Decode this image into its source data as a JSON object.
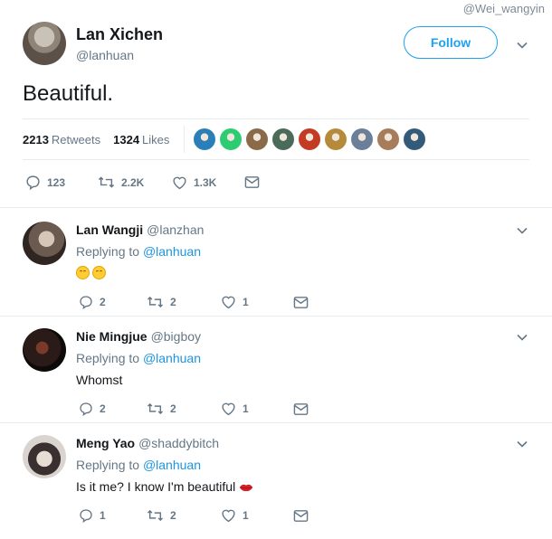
{
  "watermark": "@Wei_wangyin",
  "tweet": {
    "name": "Lan Xichen",
    "handle": "@lanhuan",
    "follow_label": "Follow",
    "text": "Beautiful.",
    "retweets_count": "2213",
    "retweets_label": "Retweets",
    "likes_count": "1324",
    "likes_label": "Likes",
    "actions": {
      "replies": "123",
      "retweets": "2.2K",
      "likes": "1.3K"
    }
  },
  "likers": [
    "#2a7fb8",
    "#2ecc71",
    "#8b6a4a",
    "#4a6b5a",
    "#c23b22",
    "#b58a3a",
    "#6b7f99",
    "#a67c5a",
    "#345a7a"
  ],
  "replies": [
    {
      "name": "Lan Wangji",
      "handle": "@lanzhan",
      "replying_prefix": "Replying to",
      "replying_to": "@lanhuan",
      "text": "",
      "actions": {
        "replies": "2",
        "retweets": "2",
        "likes": "1"
      }
    },
    {
      "name": "Nie Mingjue",
      "handle": "@bigboy",
      "replying_prefix": "Replying to",
      "replying_to": "@lanhuan",
      "text": "Whomst",
      "actions": {
        "replies": "2",
        "retweets": "2",
        "likes": "1"
      }
    },
    {
      "name": "Meng Yao",
      "handle": "@shaddybitch",
      "replying_prefix": "Replying to",
      "replying_to": "@lanhuan",
      "text": "Is it me? I know I'm beautiful",
      "actions": {
        "replies": "1",
        "retweets": "2",
        "likes": "1"
      }
    }
  ],
  "colors": {
    "accent": "#1da1f2",
    "muted": "#657786",
    "divider": "#e6ecf0",
    "text": "#14171a"
  }
}
